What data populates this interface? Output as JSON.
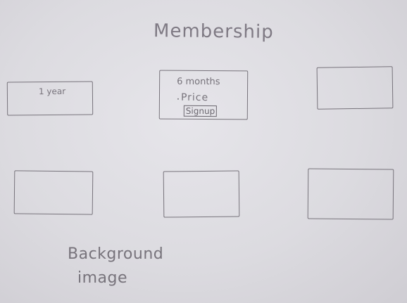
{
  "page": {
    "title": "Membership"
  },
  "cards": [
    {
      "label": "1 year"
    },
    {
      "months": "6 months",
      "price": "Price",
      "signup": "Signup"
    },
    {
      "label": ""
    },
    {
      "label": ""
    },
    {
      "label": ""
    },
    {
      "label": ""
    }
  ],
  "background_note": {
    "line1": "Background",
    "line2": "image"
  }
}
